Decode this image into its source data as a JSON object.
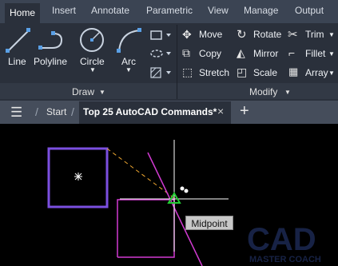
{
  "ribbon_tabs": [
    "Home",
    "Insert",
    "Annotate",
    "Parametric",
    "View",
    "Manage",
    "Output"
  ],
  "draw": {
    "line": "Line",
    "polyline": "Polyline",
    "circle": "Circle",
    "arc": "Arc",
    "panel_label": "Draw"
  },
  "modify": {
    "move": "Move",
    "rotate": "Rotate",
    "trim": "Trim",
    "copy": "Copy",
    "mirror": "Mirror",
    "fillet": "Fillet",
    "stretch": "Stretch",
    "scale": "Scale",
    "array": "Array",
    "panel_label": "Modify"
  },
  "doc_tabs": {
    "start": "Start",
    "active": "Top 25 AutoCAD Commands*",
    "close": "×",
    "add": "+"
  },
  "canvas": {
    "tooltip": "Midpoint"
  },
  "watermark": {
    "line1": "CAD",
    "line2": "MASTER COACH"
  },
  "colors": {
    "accent_rect": "#7b4fe0",
    "magenta": "#d23bd2",
    "snap": "#22cc33",
    "dash": "#f0a830"
  }
}
